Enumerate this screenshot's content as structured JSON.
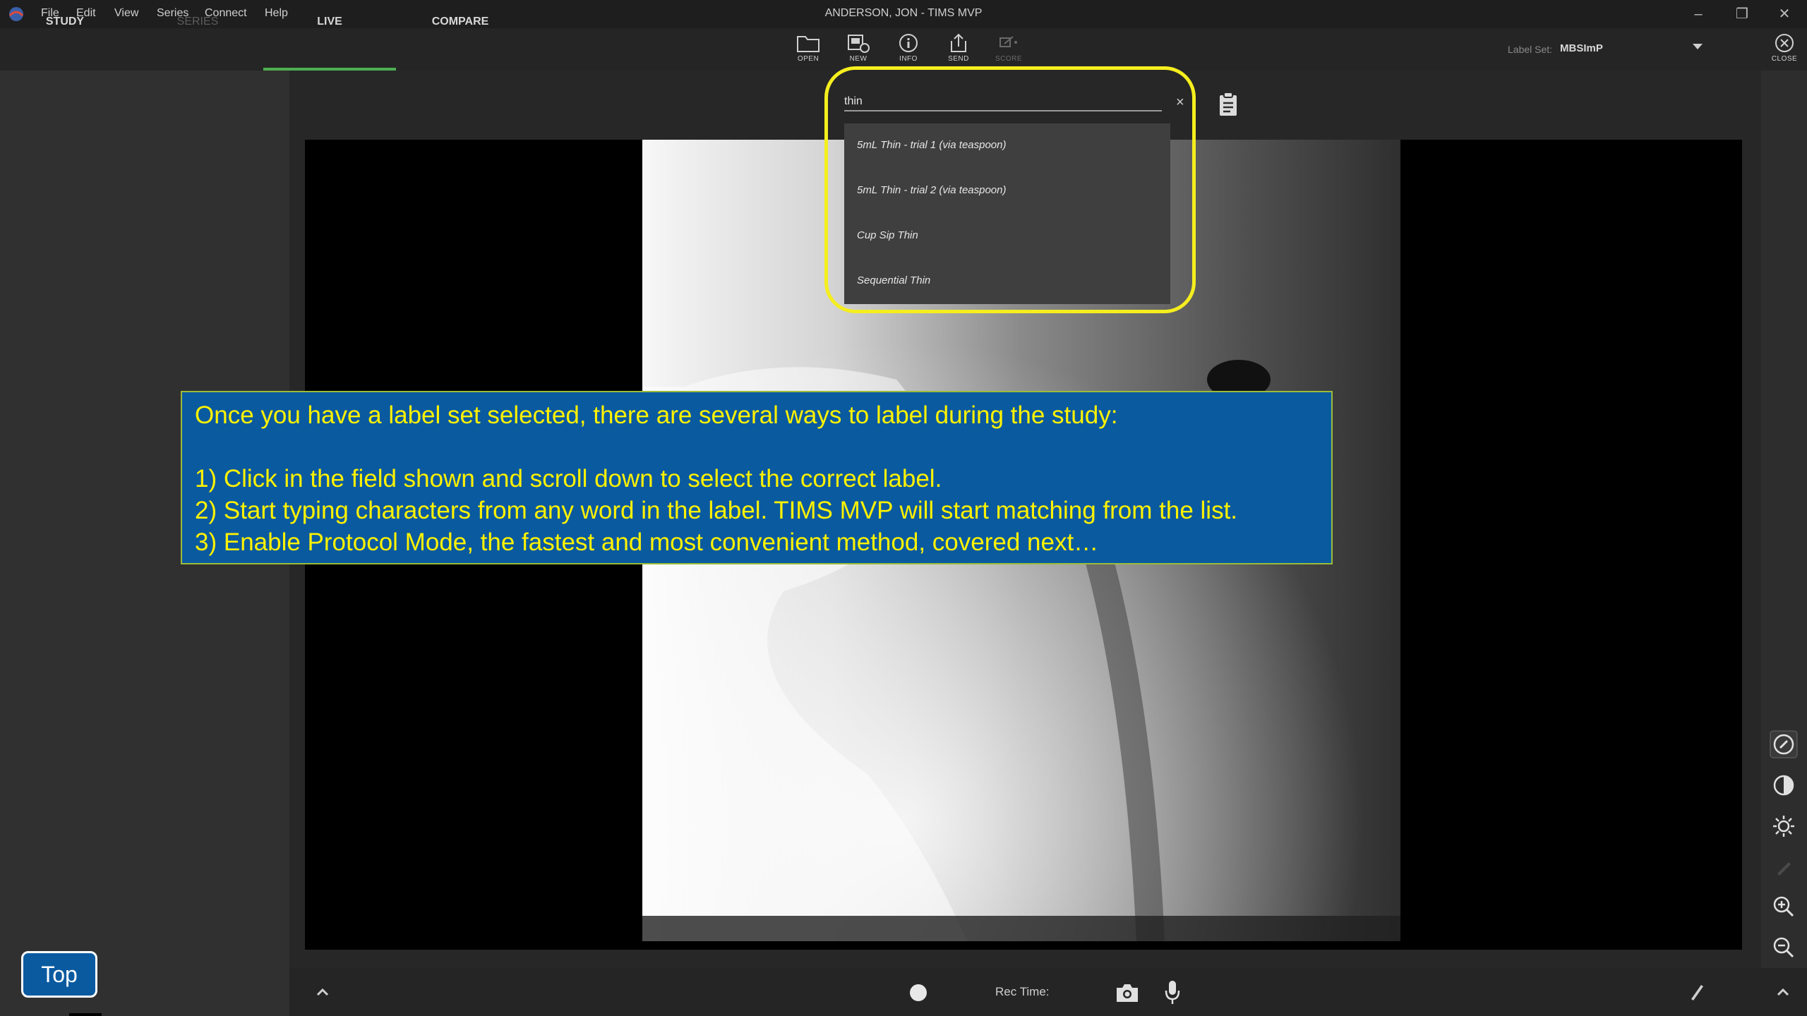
{
  "window": {
    "title": "ANDERSON, JON - TIMS MVP",
    "menu": [
      "File",
      "Edit",
      "View",
      "Series",
      "Connect",
      "Help"
    ],
    "controls": {
      "minimize": "–",
      "maximize": "❐",
      "close": "✕"
    }
  },
  "tabs": [
    {
      "label": "STUDY",
      "state": "normal"
    },
    {
      "label": "SERIES",
      "state": "disabled"
    },
    {
      "label": "LIVE",
      "state": "active"
    },
    {
      "label": "COMPARE",
      "state": "normal"
    }
  ],
  "toolbar": {
    "open": "OPEN",
    "new": "NEW",
    "info": "INFO",
    "send": "SEND",
    "score": "SCORE",
    "label_set_key": "Label Set:",
    "label_set_value": "MBSImP",
    "close": "CLOSE"
  },
  "label_search": {
    "value": "thin",
    "clear_glyph": "×",
    "suggestions": [
      "5mL Thin - trial 1 (via teaspoon)",
      "5mL Thin - trial 2 (via teaspoon)",
      "Cup Sip Thin",
      "Sequential Thin"
    ]
  },
  "callout": {
    "intro": "Once you have a label set selected, there are several ways to label during the study:",
    "steps": [
      "1) Click in the field shown and scroll down to select the correct label.",
      "2) Start typing characters from any word in the label. TIMS MVP will start matching from the list.",
      "3) Enable Protocol Mode, the fastest and most convenient method, covered next…"
    ]
  },
  "bottom_bar": {
    "rec_time_label": "Rec Time:"
  },
  "top_button": "Top",
  "colors": {
    "accent_green": "#4caf50",
    "highlight_yellow": "#f5ee1e",
    "callout_blue": "#0a5aa0",
    "callout_text": "#fff200"
  },
  "icons": [
    "app-logo",
    "open-folder-icon",
    "new-series-icon",
    "info-icon",
    "send-icon",
    "score-icon",
    "close-circle-icon",
    "clipboard-icon",
    "compass-icon",
    "contrast-icon",
    "brightness-icon",
    "pen-icon",
    "zoom-in-icon",
    "zoom-out-icon",
    "record-icon",
    "camera-icon",
    "microphone-icon",
    "expand-up-icon"
  ]
}
